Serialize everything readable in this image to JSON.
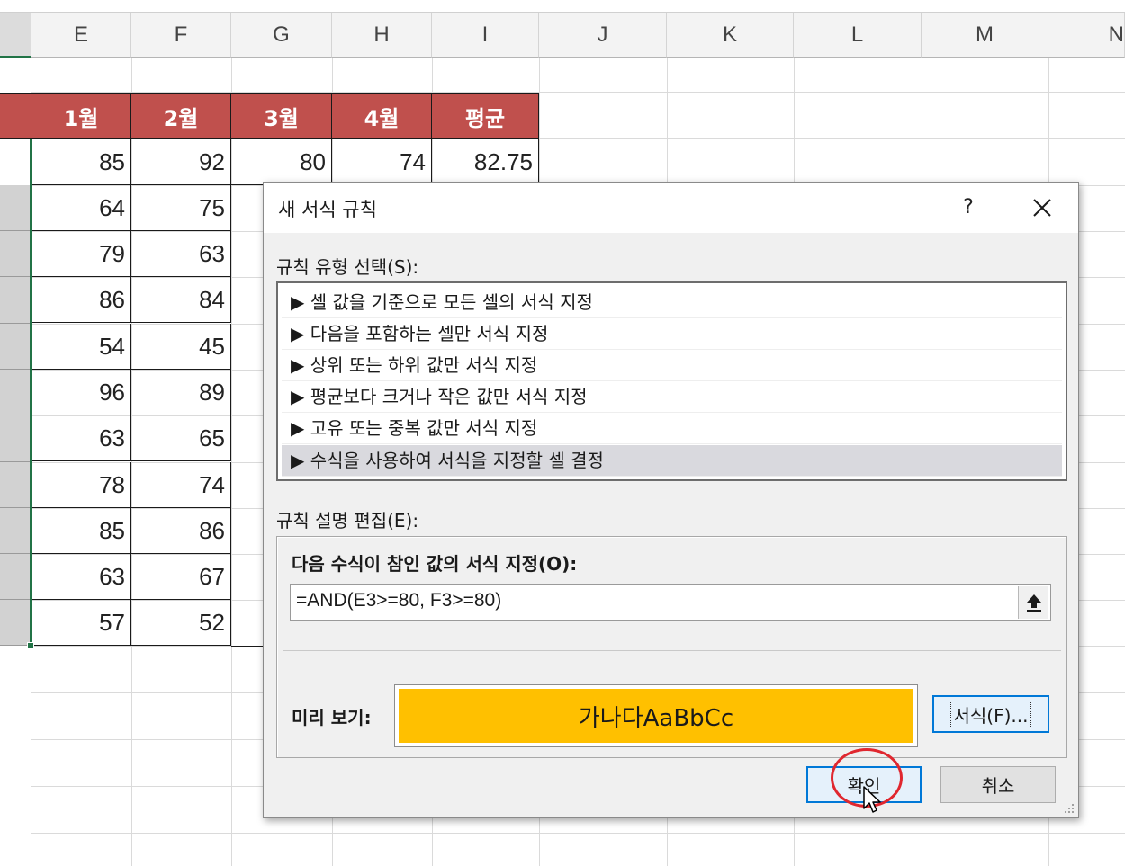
{
  "columns": [
    "E",
    "F",
    "G",
    "H",
    "I",
    "J",
    "K",
    "L",
    "M",
    "N"
  ],
  "table": {
    "headers": [
      "1월",
      "2월",
      "3월",
      "4월",
      "평균"
    ],
    "rows": [
      [
        "85",
        "92",
        "80",
        "74",
        "82.75"
      ],
      [
        "64",
        "75"
      ],
      [
        "79",
        "63"
      ],
      [
        "86",
        "84"
      ],
      [
        "54",
        "45"
      ],
      [
        "96",
        "89"
      ],
      [
        "63",
        "65"
      ],
      [
        "78",
        "74"
      ],
      [
        "85",
        "86"
      ],
      [
        "63",
        "67"
      ],
      [
        "57",
        "52"
      ]
    ],
    "header_color": "#c0504d"
  },
  "dialog": {
    "title": "새 서식 규칙",
    "help_label": "?",
    "close_icon": "close-icon",
    "rule_type_label": "규칙 유형 선택(S):",
    "rule_types": [
      "▶ 셀 값을 기준으로 모든 셀의 서식 지정",
      "▶ 다음을 포함하는 셀만 서식 지정",
      "▶ 상위 또는 하위 값만 서식 지정",
      "▶ 평균보다 크거나 작은 값만 서식 지정",
      "▶ 고유 또는 중복 값만 서식 지정",
      "▶ 수식을 사용하여 서식을 지정할 셀 결정"
    ],
    "selected_rule_index": 5,
    "rule_desc_label": "규칙 설명 편집(E):",
    "formula_heading": "다음 수식이 참인 값의 서식 지정(O):",
    "formula_value": "=AND(E3>=80, F3>=80)",
    "preview_label": "미리 보기:",
    "preview_text": "가나다AaBbCc",
    "preview_color": "#ffc000",
    "format_button": "서식(F)...",
    "ok_button": "확인",
    "cancel_button": "취소"
  }
}
